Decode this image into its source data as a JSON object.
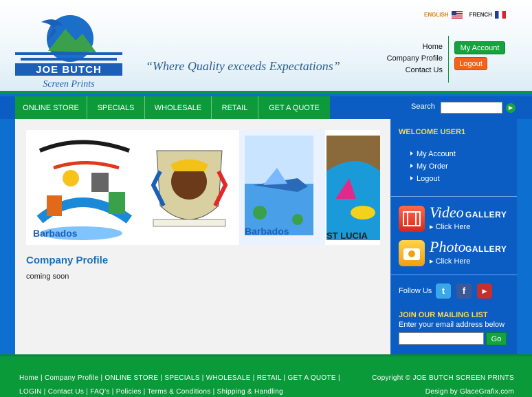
{
  "header": {
    "tagline": "“Where Quality exceeds Expectations”",
    "logo_text_1": "JOE BUTCH",
    "logo_text_2": "Screen Prints",
    "lang_en": "ENGLISH",
    "lang_fr": "FRENCH",
    "links": [
      "Home",
      "Company Profile",
      "Contact Us"
    ],
    "my_account": "My Account",
    "logout": "Logout"
  },
  "nav": {
    "items": [
      "ONLINE STORE",
      "SPECIALS",
      "WHOLESALE",
      "RETAIL",
      "GET A QUOTE"
    ],
    "search_label": "Search"
  },
  "main": {
    "banner_labels": [
      "Barbados",
      "Barbados",
      "ST LUCIA"
    ],
    "title": "Company Profile",
    "body": "coming soon"
  },
  "sidebar": {
    "welcome": "WELCOME USER1",
    "links": [
      "My Account",
      "My Order",
      "Logout"
    ],
    "video_title": "Video",
    "photo_title": "Photo",
    "gallery_word": "GALLERY",
    "click_here": "Click Here",
    "follow": "Follow Us",
    "mail_title": "JOIN OUR MAILING LIST",
    "mail_sub": "Enter your email address below",
    "go": "Go"
  },
  "footer": {
    "line1": [
      "Home",
      "Company Profile",
      "ONLINE STORE",
      "SPECIALS",
      "WHOLESALE",
      "RETAIL",
      "GET A QUOTE",
      ""
    ],
    "line2": [
      "LOGIN",
      "Contact Us",
      "FAQ's",
      "Policies",
      "Terms & Conditions",
      "Shipping & Handling"
    ],
    "copyright": "Copyright © JOE BUTCH SCREEN PRINTS",
    "design": "Design by GlaceGrafix.com"
  },
  "colors": {
    "green": "#0c9a3a",
    "blue": "#0b5dc4",
    "orange": "#f2641a",
    "yellow": "#fddc4a"
  }
}
